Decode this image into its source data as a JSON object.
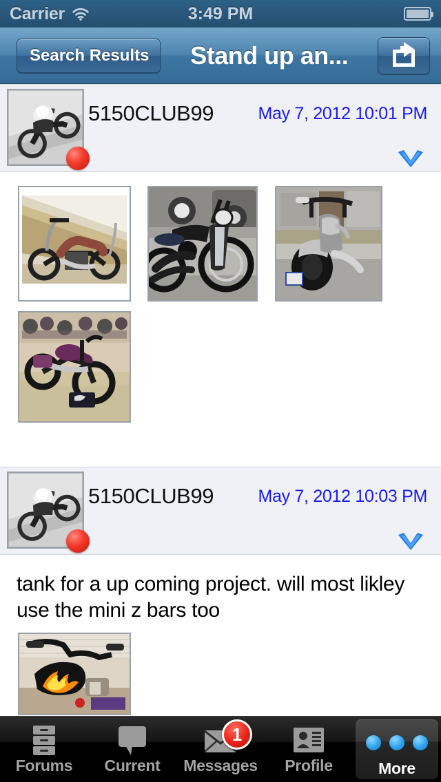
{
  "status_bar": {
    "carrier": "Carrier",
    "time": "3:49 PM",
    "wifi_icon": "wifi-icon",
    "battery_icon": "battery-icon"
  },
  "nav_bar": {
    "back_label": "Search Results",
    "title": "Stand up an...",
    "share_icon": "share-icon"
  },
  "posts": [
    {
      "username": "5150CLUB99",
      "timestamp": "May 7, 2012 10:01 PM",
      "avatar_icon": "avatar-motorcycle-photo",
      "status_dot_color": "#f53b2c",
      "expand_icon": "chevron-down-icon",
      "body_text": "",
      "attachments": [
        {
          "name": "attachment-bobber-hillside",
          "alt": "brown tank chopper on hillside"
        },
        {
          "name": "attachment-black-bobber",
          "alt": "black bobber in front of truck"
        },
        {
          "name": "attachment-silver-rear",
          "alt": "silver motorcycle rear view on street"
        },
        {
          "name": "attachment-purple-show-bike",
          "alt": "purple chopper at indoor bike show"
        }
      ]
    },
    {
      "username": "5150CLUB99",
      "timestamp": "May 7, 2012 10:03 PM",
      "avatar_icon": "avatar-motorcycle-photo",
      "status_dot_color": "#f53b2c",
      "expand_icon": "chevron-down-icon",
      "body_text": "tank for a up coming project. will most likley use the mini z bars too",
      "attachments": [
        {
          "name": "attachment-flame-tank",
          "alt": "flame painted gas tank with z bars"
        }
      ]
    }
  ],
  "tab_bar": {
    "items": [
      {
        "label": "Forums",
        "icon": "filing-cabinet-icon",
        "selected": false,
        "badge": ""
      },
      {
        "label": "Current",
        "icon": "speech-bubble-icon",
        "selected": false,
        "badge": ""
      },
      {
        "label": "Messages",
        "icon": "envelope-icon",
        "selected": false,
        "badge": "1"
      },
      {
        "label": "Profile",
        "icon": "contact-card-icon",
        "selected": false,
        "badge": ""
      },
      {
        "label": "More",
        "icon": "three-dots-icon",
        "selected": true,
        "badge": ""
      }
    ]
  },
  "colors": {
    "nav_blue": "#3d76a2",
    "link_blue": "#1a1af0",
    "post_header_bg": "#eff1f6",
    "badge_red": "#e8241a",
    "tab_blue": "#34a7ef"
  }
}
